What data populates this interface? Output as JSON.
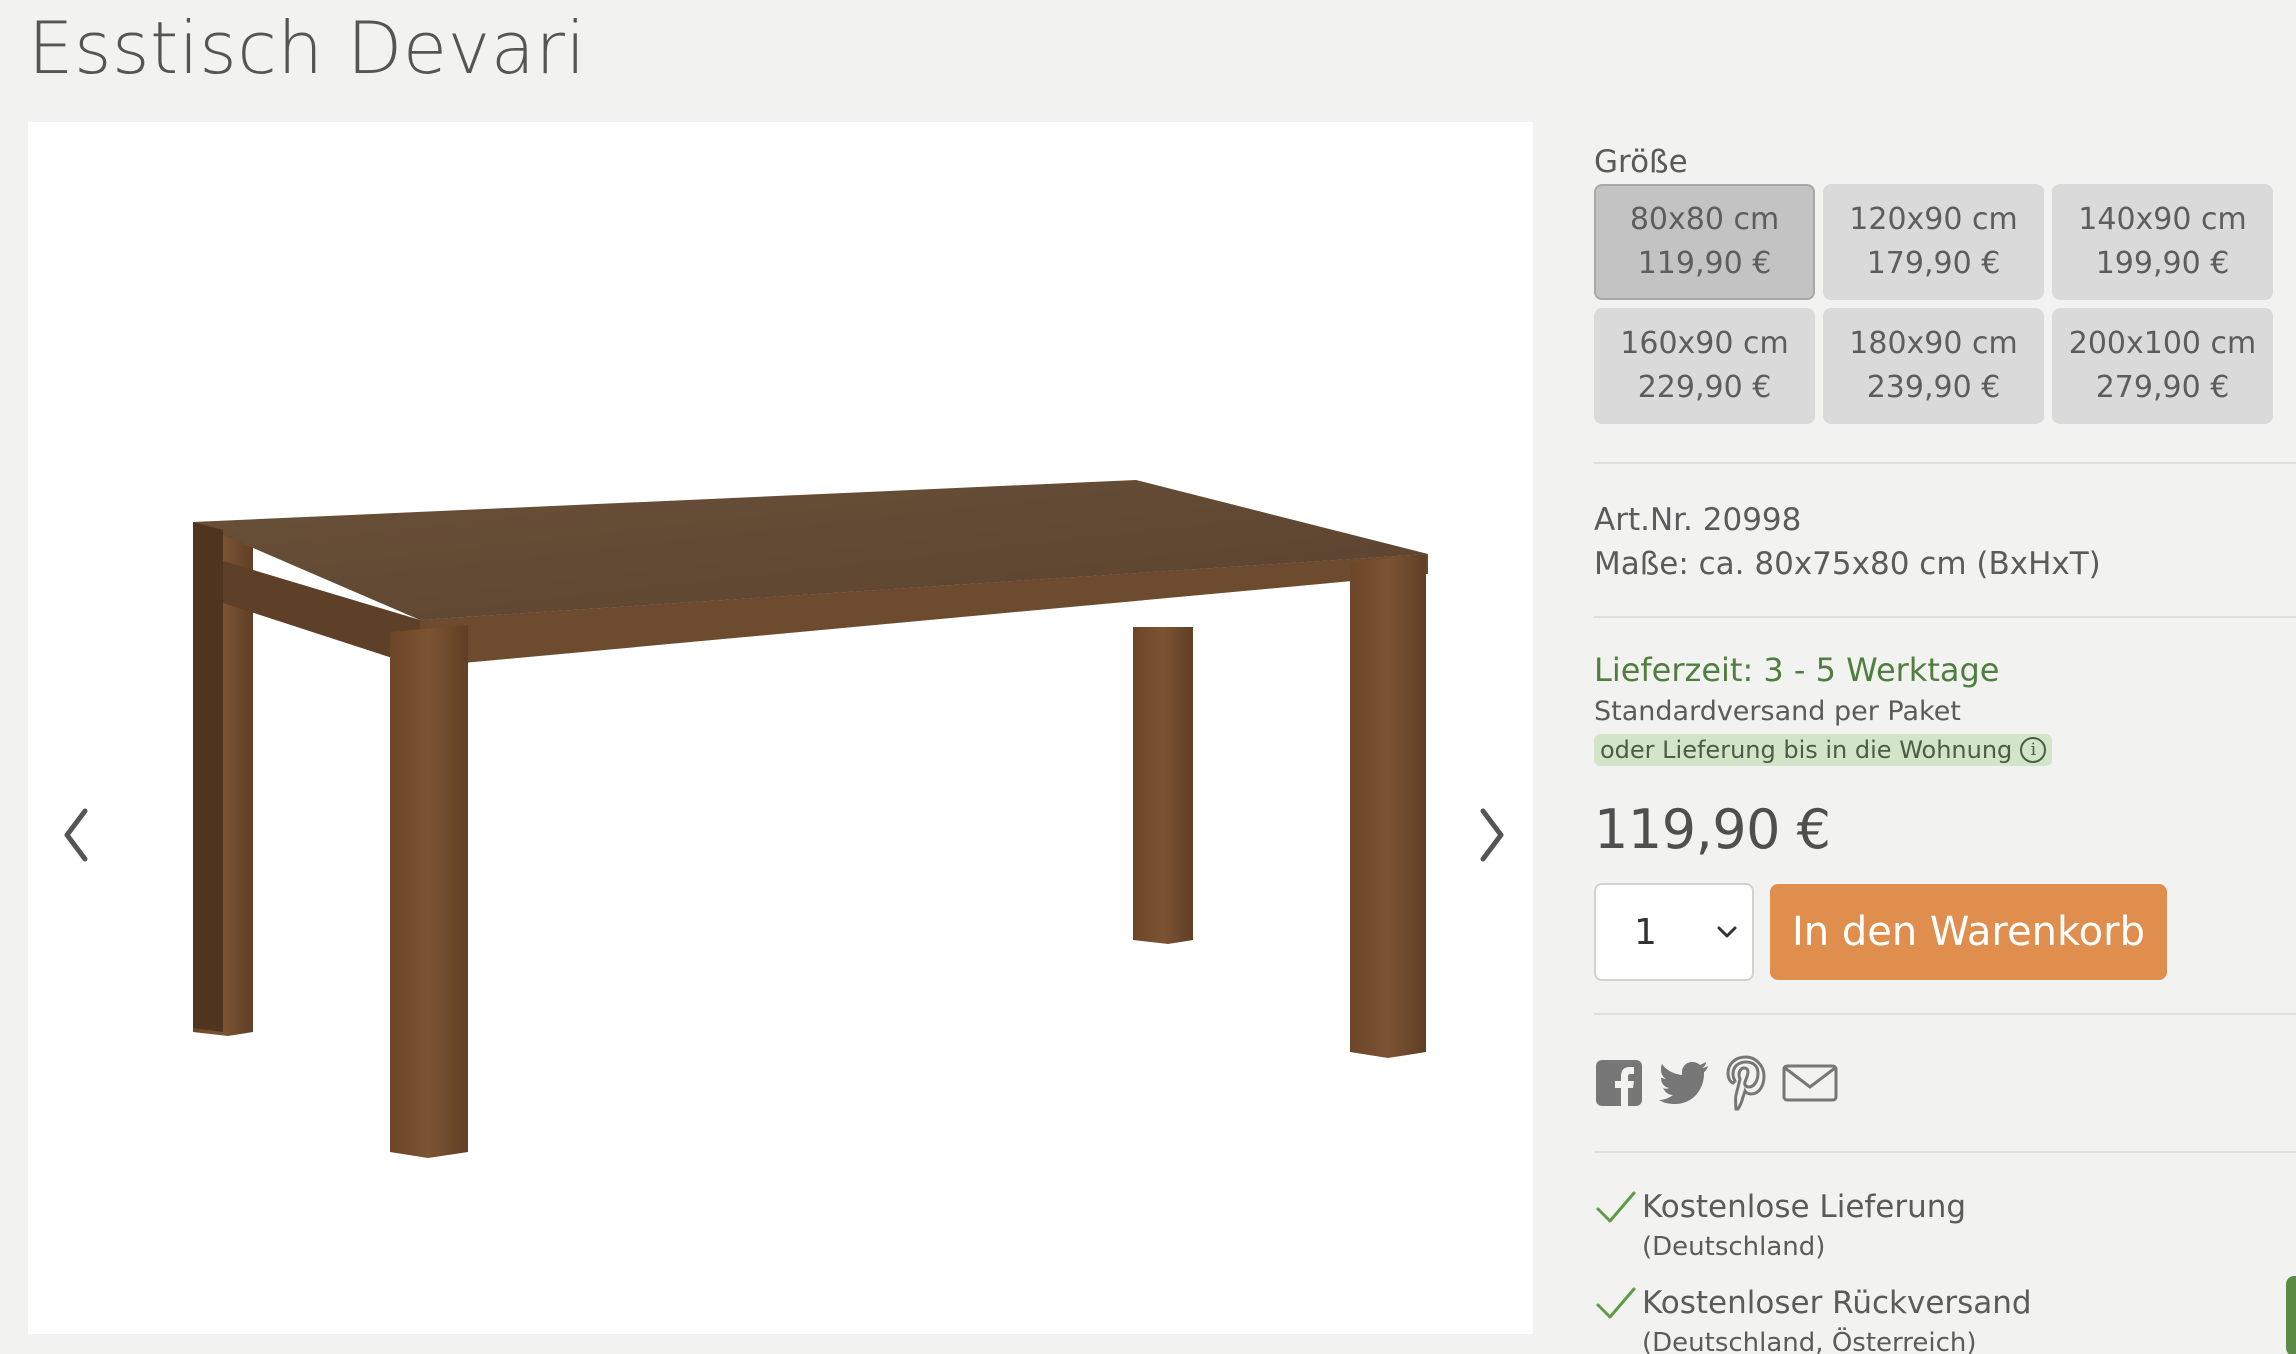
{
  "product": {
    "title": "Esstisch Devari"
  },
  "gallery": {
    "prev_icon": "chevron-left-icon",
    "next_icon": "chevron-right-icon"
  },
  "size": {
    "label": "Größe",
    "options": [
      {
        "dim": "80x80 cm",
        "price": "119,90 €",
        "selected": true
      },
      {
        "dim": "120x90 cm",
        "price": "179,90 €",
        "selected": false
      },
      {
        "dim": "140x90 cm",
        "price": "199,90 €",
        "selected": false
      },
      {
        "dim": "160x90 cm",
        "price": "229,90 €",
        "selected": false
      },
      {
        "dim": "180x90 cm",
        "price": "239,90 €",
        "selected": false
      },
      {
        "dim": "200x100 cm",
        "price": "279,90 €",
        "selected": false
      }
    ]
  },
  "details": {
    "art_nr": "Art.Nr. 20998",
    "dimensions": "Maße: ca. 80x75x80 cm (BxHxT)"
  },
  "delivery": {
    "time": "Lieferzeit: 3 - 5 Werktage",
    "shipping": "Standardversand per Paket",
    "home_delivery": "oder Lieferung bis in die Wohnung",
    "info_icon": "info-icon"
  },
  "price": "119,90 €",
  "cart": {
    "quantity": "1",
    "button_label": "In den Warenkorb"
  },
  "social": {
    "icons": [
      "facebook-icon",
      "twitter-icon",
      "pinterest-icon",
      "mail-icon"
    ]
  },
  "benefits": [
    {
      "title": "Kostenlose Lieferung",
      "sub": "(Deutschland)"
    },
    {
      "title": "Kostenloser Rückversand",
      "sub": "(Deutschland, Österreich)"
    }
  ],
  "colors": {
    "background": "#f2f2f1",
    "accent_button": "#e08e4e",
    "delivery_green": "#4f7e3f",
    "highlight_green": "#d3e5c8"
  }
}
